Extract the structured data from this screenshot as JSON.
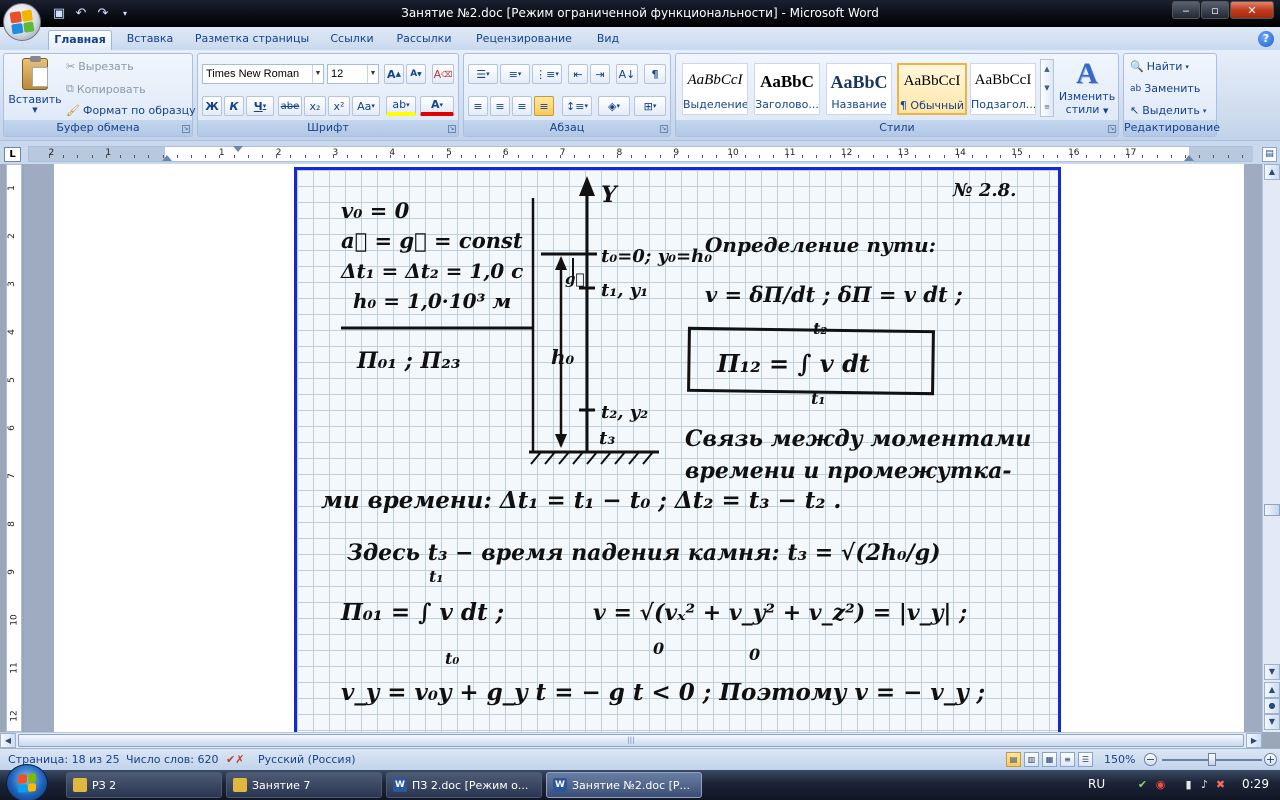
{
  "window": {
    "title": "Занятие №2.doc [Режим ограниченной функциональности] - Microsoft Word",
    "controls": {
      "minimize": "‒",
      "maximize": "▫",
      "close": "✕"
    }
  },
  "quick_access": {
    "save_icon": "floppy-disk-icon",
    "undo_icon": "undo-icon",
    "redo_icon": "redo-icon",
    "customize_icon": "dropdown-icon"
  },
  "tabs": [
    {
      "label": "Главная",
      "active": true
    },
    {
      "label": "Вставка"
    },
    {
      "label": "Разметка страницы"
    },
    {
      "label": "Ссылки"
    },
    {
      "label": "Рассылки"
    },
    {
      "label": "Рецензирование"
    },
    {
      "label": "Вид"
    }
  ],
  "ribbon": {
    "clipboard": {
      "label": "Буфер обмена",
      "paste": "Вставить",
      "cut": "Вырезать",
      "copy": "Копировать",
      "format_painter": "Формат по образцу"
    },
    "font": {
      "label": "Шрифт",
      "family": "Times New Roman",
      "size": "12",
      "grow": "A",
      "shrink": "A",
      "clear": "A",
      "bold": "Ж",
      "italic": "К",
      "underline": "Ч",
      "strike": "abe",
      "subscript": "x₂",
      "superscript": "x²",
      "change_case": "Aa",
      "highlight": "ab",
      "font_color": "A"
    },
    "paragraph": {
      "label": "Абзац",
      "show_marks": "¶"
    },
    "styles": {
      "label": "Стили",
      "items": [
        {
          "sample": "AaBbCcI",
          "name": "Выделение"
        },
        {
          "sample": "AaBbC",
          "name": "Заголово..."
        },
        {
          "sample": "AaBbC",
          "name": "Название"
        },
        {
          "sample": "AaBbCcI",
          "name": "¶ Обычный",
          "selected": true
        },
        {
          "sample": "AaBbCcI",
          "name": "Подзагол..."
        }
      ],
      "change_styles": [
        "Изменить",
        "стили"
      ]
    },
    "editing": {
      "label": "Редактирование",
      "find": "Найти",
      "replace": "Заменить",
      "select": "Выделить"
    }
  },
  "ruler": {
    "corner": "L",
    "marks": [
      "2",
      "1",
      "1",
      "2",
      "3",
      "4",
      "5",
      "6",
      "7",
      "8",
      "9",
      "10",
      "11",
      "12",
      "13",
      "14",
      "15",
      "16",
      "17"
    ],
    "vmarks": [
      "1",
      "2",
      "3",
      "4",
      "5",
      "6",
      "7",
      "8",
      "9",
      "10",
      "11",
      "12"
    ]
  },
  "document": {
    "problem_number": "№ 2.8.",
    "lines": {
      "g1": "v₀ = 0",
      "g2": "a⃗ = g⃗ = const",
      "g3": "Δt₁ = Δt₂ = 1,0 c",
      "g4": "h₀ = 1,0·10³ м",
      "find": "П₀₁ ; П₂₃",
      "axis": "Y",
      "pt0": "t₀=0; y₀=h₀",
      "pt1": "t₁, y₁",
      "pt2": "t₂, y₂",
      "pt3": "t₃",
      "h0": "h₀",
      "g_vec": "g⃗",
      "def_title": "Определение пути:",
      "def_eq": "v = δП/dt ;  δП = v dt ;",
      "box_eq": "П₁₂ = ∫ v dt",
      "int_hi": "t₂",
      "int_lo": "t₁",
      "link1": "Связь между моментами",
      "link2": "времени и промежутка-",
      "link3": "ми времени:  Δt₁ = t₁ − t₀ ;  Δt₂ = t₃ − t₂ .",
      "here": "Здесь t₃ − время падения камня:  t₃ = √(2h₀/g)",
      "p01": "П₀₁ = ∫ v dt  ;",
      "p01_hi": "t₁",
      "p01_lo": "t₀",
      "vmag": "v = √(vₓ² + v_y² + v_z²) = |v_y| ;",
      "zero1": "0",
      "zero2": "0",
      "vy": "v_y = v₀y + g_y t = − g t < 0 ;  Поэтому  v = − v_y ;"
    }
  },
  "status": {
    "page": "Страница: 18 из 25",
    "words": "Число слов: 620",
    "language": "Русский (Россия)",
    "zoom": "150%",
    "zoom_level": 0.5
  },
  "taskbar": {
    "items": [
      {
        "label": "РЗ 2",
        "icon": "folder-icon"
      },
      {
        "label": "Занятие 7",
        "icon": "folder-icon"
      },
      {
        "label": "ПЗ 2.doc [Режим о...",
        "icon": "word-doc-icon"
      },
      {
        "label": "Занятие №2.doc [Р...",
        "icon": "word-doc-icon",
        "active": true
      }
    ],
    "tray_lang": "RU",
    "clock": "0:29"
  },
  "colors": {
    "frame": "#1428d8",
    "ribbon_text": "#15428b",
    "selected_style": "#f0b341"
  }
}
